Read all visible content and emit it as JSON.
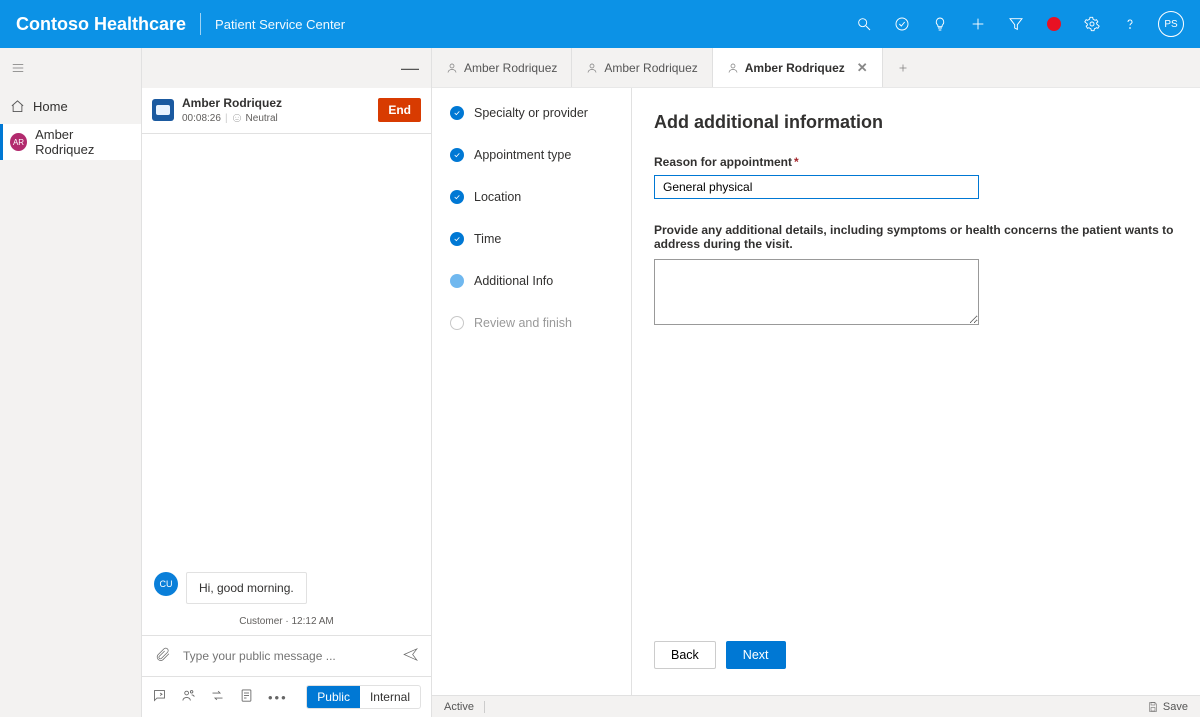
{
  "header": {
    "brand": "Contoso Healthcare",
    "sub_app": "Patient Service Center",
    "avatar_initials": "PS"
  },
  "nav": {
    "home": "Home",
    "patient": {
      "initials": "AR",
      "name": "Amber Rodriquez"
    }
  },
  "chat": {
    "name": "Amber Rodriquez",
    "timer": "00:08:26",
    "sentiment": "Neutral",
    "end_label": "End",
    "message_text": "Hi, good morning.",
    "message_avatar": "CU",
    "message_meta": "Customer · 12:12 AM",
    "input_placeholder": "Type your public message ...",
    "toggle_public": "Public",
    "toggle_internal": "Internal"
  },
  "tabs": {
    "t1": "Amber Rodriquez",
    "t2": "Amber Rodriquez",
    "t3": "Amber Rodriquez"
  },
  "steps": {
    "s1": "Specialty or provider",
    "s2": "Appointment type",
    "s3": "Location",
    "s4": "Time",
    "s5": "Additional Info",
    "s6": "Review and finish"
  },
  "form": {
    "heading": "Add additional information",
    "reason_label": "Reason for appointment",
    "reason_value": "General physical",
    "details_label": "Provide any additional details, including symptoms or health concerns the patient wants to address during the visit.",
    "back": "Back",
    "next": "Next"
  },
  "footer": {
    "status": "Active",
    "save": "Save"
  }
}
